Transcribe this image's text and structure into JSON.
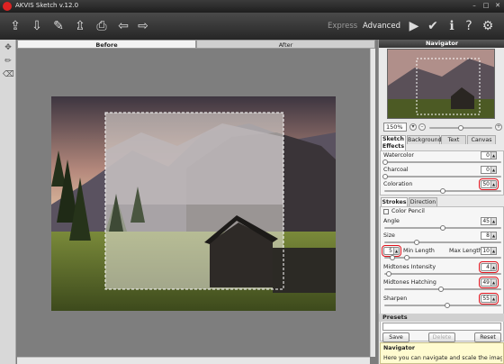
{
  "window": {
    "title": "AKVIS Sketch v.12.0"
  },
  "toolbar": {
    "modes": {
      "express": "Express",
      "advanced": "Advanced"
    }
  },
  "canvas_tabs": {
    "before": "Before",
    "after": "After"
  },
  "navigator": {
    "title": "Navigator",
    "zoom": "150%"
  },
  "panel_tabs": [
    "Sketch Effects",
    "Background",
    "Text",
    "Canvas"
  ],
  "effects": {
    "watercolor": {
      "label": "Watercolor",
      "value": "0",
      "level": 0
    },
    "charcoal": {
      "label": "Charcoal",
      "value": "0",
      "level": 0
    },
    "coloration": {
      "label": "Coloration",
      "value": "50",
      "level": 0.5
    }
  },
  "strokes_tabs": [
    "Strokes",
    "Direction"
  ],
  "strokes": {
    "color_pencil": "Color Pencil",
    "angle": {
      "label": "Angle",
      "value": "45",
      "level": 0.5
    },
    "size": {
      "label": "Size",
      "value": "8",
      "level": 0.27
    },
    "min_length": {
      "label": "Min Length",
      "value": "5"
    },
    "max_length": {
      "label": "Max Length",
      "value": "10"
    },
    "midtones_intensity": {
      "label": "Midtones Intensity",
      "value": "4",
      "level": 0.04
    },
    "midtones_hatching": {
      "label": "Midtones Hatching",
      "value": "49",
      "level": 0.49
    },
    "sharpen": {
      "label": "Sharpen",
      "value": "55",
      "level": 0.55
    }
  },
  "presets": {
    "title": "Presets",
    "save": "Save",
    "delete": "Delete",
    "reset": "Reset"
  },
  "help": {
    "title": "Navigator",
    "text": "Here you can navigate and scale the image. The"
  },
  "colors": {
    "highlight": "#e0121c",
    "panel_header": "#454545"
  }
}
